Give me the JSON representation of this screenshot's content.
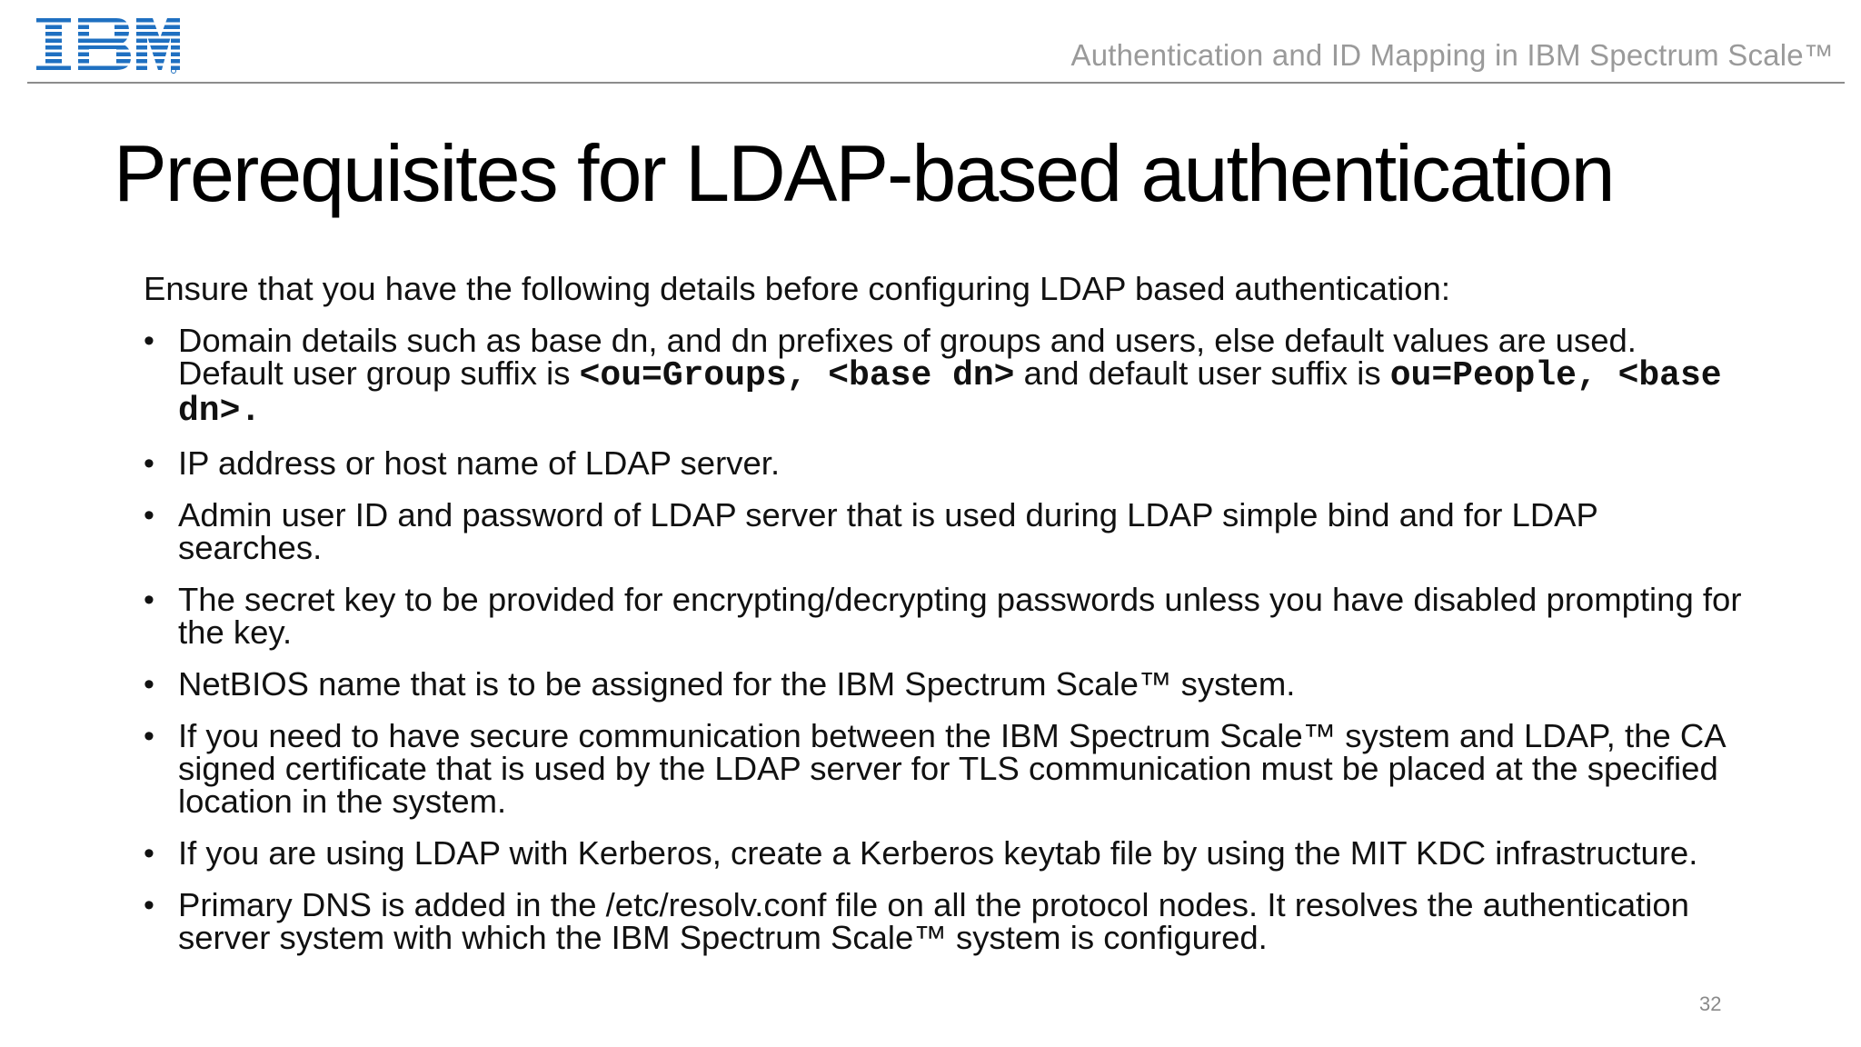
{
  "header": {
    "logo_text": "IBM",
    "title": "Authentication and ID Mapping in IBM Spectrum Scale™"
  },
  "page_title": "Prerequisites for LDAP-based authentication",
  "intro": "Ensure that you have the following details before configuring LDAP based authentication:",
  "bullets": {
    "b1": {
      "text_a": "Domain details such as base dn, and dn prefixes of groups and users, else default values are used. Default user group suffix is ",
      "code_a": "<ou=Groups, <base dn>",
      "text_b": " and default user suffix is ",
      "code_b": "ou=People, <base dn>."
    },
    "b2": "IP address or host name of LDAP server.",
    "b3": "Admin user ID and password of LDAP server that is used during LDAP simple bind and for LDAP searches.",
    "b4": "The secret key to be provided for encrypting/decrypting passwords unless you have disabled prompting for the key.",
    "b5": "NetBIOS name that is to be assigned for the IBM Spectrum Scale™ system.",
    "b6": "If you need to have secure communication between the IBM Spectrum Scale™ system and LDAP, the CA signed certificate that is used by the LDAP server for TLS communication must be placed at the specified location in the system.",
    "b7": "If you are using LDAP with Kerberos, create a Kerberos keytab file by using the MIT KDC infrastructure.",
    "b8": "Primary DNS is added in the /etc/resolv.conf file on all the protocol nodes. It resolves the authentication server system with which the IBM Spectrum Scale™ system is configured."
  },
  "bullet_glyph": "•",
  "page_number": "32",
  "colors": {
    "logo_blue": "#1f70c1",
    "header_text": "#9a9a9a",
    "rule": "#8c8c8c"
  }
}
